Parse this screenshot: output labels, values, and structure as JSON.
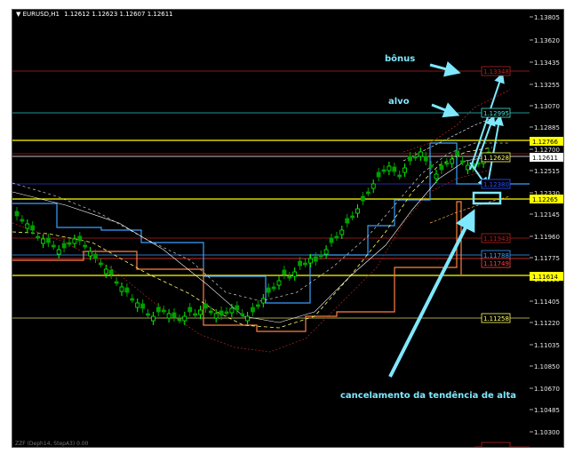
{
  "header": {
    "symbol": "EURUSD,H1",
    "ohlc": "1.12612 1.12623 1.12607 1.12611",
    "dropdown_icon": "triangle-down-icon"
  },
  "footer_indicator": "ZZF (Deph14, StepA3) 0.00",
  "price_axis": {
    "ticks": [
      "1.13805",
      "1.13620",
      "1.13435",
      "1.13255",
      "1.13070",
      "1.12885",
      "1.12700",
      "1.12515",
      "1.12330",
      "1.12145",
      "1.11960",
      "1.11775",
      "1.11590",
      "1.11405",
      "1.11220",
      "1.11035",
      "1.10850",
      "1.10670",
      "1.10485",
      "1.10300"
    ]
  },
  "price_labels": [
    {
      "text": "1.12766",
      "color": "#ffff00",
      "text_color": "#000000"
    },
    {
      "text": "1.12611",
      "color": "#ffffff",
      "text_color": "#000000"
    },
    {
      "text": "1.12265",
      "color": "#ffff00",
      "text_color": "#000000"
    },
    {
      "text": "1.11614",
      "color": "#ffff00",
      "text_color": "#000000"
    }
  ],
  "level_labels": [
    {
      "text": "1.13348",
      "color": "#b22222"
    },
    {
      "text": "1.12995",
      "color": "#40e0d0"
    },
    {
      "text": "1.12628",
      "color": "#ffff66"
    },
    {
      "text": "1.12380",
      "color": "#3050ff"
    },
    {
      "text": "1.11943",
      "color": "#b22222"
    },
    {
      "text": "1.11788",
      "color": "#3aa0ff"
    },
    {
      "text": "1.11749",
      "color": "#ff4040"
    },
    {
      "text": "1.11258",
      "color": "#ffff66"
    },
    {
      "text": "",
      "color": "#b22222"
    }
  ],
  "annotations": {
    "bonus": "bônus",
    "target": "alvo",
    "cancel": "cancelamento da tendência de alta"
  },
  "colors": {
    "background": "#000000",
    "up_candle": "#00ff00",
    "annotation": "#7fe8ff",
    "yellow_level": "#ffff00",
    "teal_level": "#40e0d0",
    "red_level": "#b22222"
  }
}
